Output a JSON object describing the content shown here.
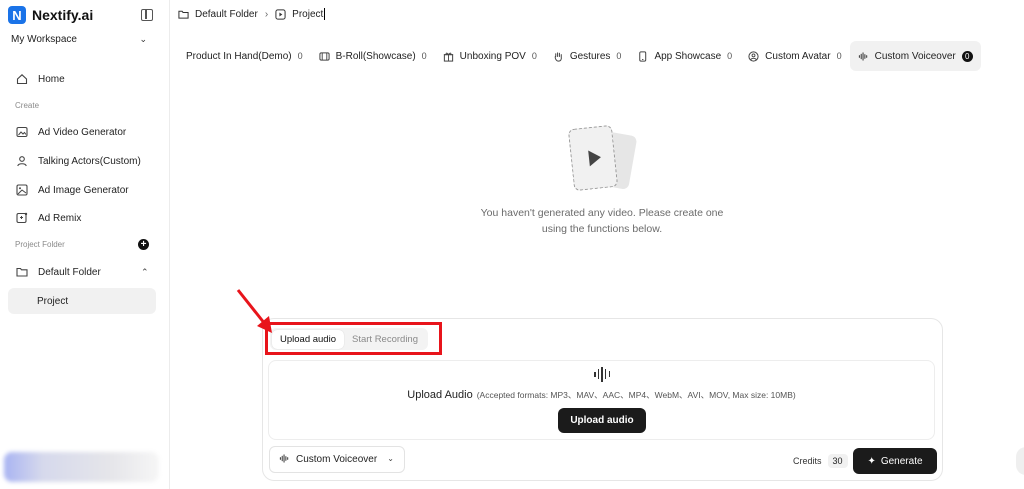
{
  "app": {
    "brand_name": "Nextify.ai",
    "brand_letter": "N",
    "brand_color": "#1a73e8"
  },
  "sidebar": {
    "workspace": "My Workspace",
    "home": "Home",
    "create_label": "Create",
    "create_items": [
      {
        "label": "Ad Video Generator",
        "icon": "film-image-icon"
      },
      {
        "label": "Talking Actors(Custom)",
        "icon": "person-icon"
      },
      {
        "label": "Ad Image Generator",
        "icon": "image-icon"
      },
      {
        "label": "Ad Remix",
        "icon": "remix-icon"
      }
    ],
    "project_folder_label": "Project Folder",
    "folder_name": "Default Folder",
    "project_name": "Project"
  },
  "breadcrumb": {
    "folder": "Default Folder",
    "project": "Project"
  },
  "tabs": [
    {
      "label": "Product In Hand(Demo)",
      "count": "0",
      "icon": ""
    },
    {
      "label": "B-Roll(Showcase)",
      "count": "0",
      "icon": "film-icon"
    },
    {
      "label": "Unboxing POV",
      "count": "0",
      "icon": "gift-icon"
    },
    {
      "label": "Gestures",
      "count": "0",
      "icon": "hand-icon"
    },
    {
      "label": "App Showcase",
      "count": "0",
      "icon": "phone-icon"
    },
    {
      "label": "Custom Avatar",
      "count": "0",
      "icon": "avatar-icon"
    },
    {
      "label": "Custom Voiceover",
      "count": "0",
      "icon": "waveform-icon"
    }
  ],
  "empty_state": {
    "message": "You haven't generated any video. Please create one using the functions below."
  },
  "panel": {
    "mode_tabs": [
      "Upload audio",
      "Start Recording"
    ],
    "active_mode": "Upload audio",
    "upload_title": "Upload Audio",
    "upload_formats": "(Accepted formats: MP3、MAV、AAC、MP4、WebM、AVI、MOV, Max size: 10MB)",
    "upload_button": "Upload audio",
    "voice_select": "Custom Voiceover",
    "credits_label": "Credits",
    "credits_value": "30",
    "generate_button": "Generate"
  },
  "colors": {
    "annotation_red": "#e8141b",
    "primary_dark": "#1b1b1b"
  }
}
